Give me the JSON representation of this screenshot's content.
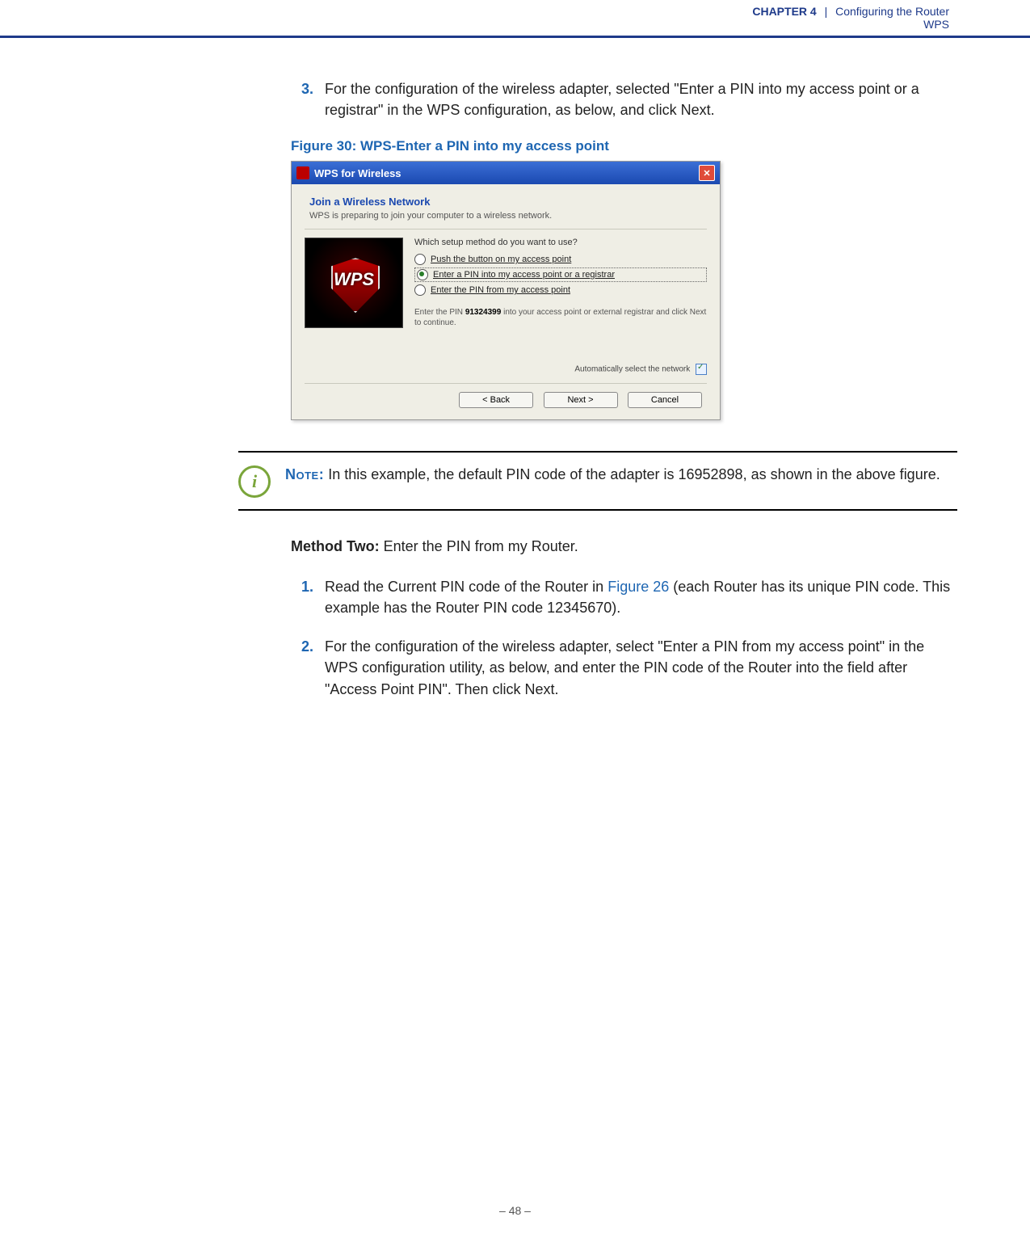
{
  "header": {
    "chapter_label": "CHAPTER 4",
    "pipe": "|",
    "title": "Configuring the Router",
    "subtitle": "WPS"
  },
  "step3": {
    "num": "3.",
    "text": "For the configuration of the wireless adapter, selected \"Enter a PIN into my access point or a registrar\" in the WPS configuration, as below, and click Next."
  },
  "figure_caption": "Figure 30:  WPS-Enter a PIN into my access point",
  "dialog": {
    "title": "WPS for Wireless",
    "join_title": "Join a Wireless Network",
    "join_sub": "WPS is preparing to join your computer to a wireless network.",
    "question": "Which setup method do you want to use?",
    "opt1": "Push the button on my access point",
    "opt2": "Enter a PIN into my access point or a registrar",
    "opt3": "Enter the PIN from my access point",
    "pin_prefix": "Enter the PIN ",
    "pin_value": "91324399",
    "pin_suffix": " into your access point or external registrar and click Next to continue.",
    "auto_label": "Automatically select the network",
    "back": "< Back",
    "next": "Next >",
    "cancel": "Cancel"
  },
  "note": {
    "label": "Note:",
    "text": " In this example, the default PIN code of the adapter is 16952898, as shown in the above figure."
  },
  "method2": {
    "bold": "Method Two:",
    "rest": " Enter the PIN from my Router."
  },
  "m2_step1": {
    "num": "1.",
    "pre": "Read the Current PIN code of the Router in ",
    "figlink": "Figure 26",
    "post": " (each Router has its unique PIN code. This example has the Router PIN code 12345670)."
  },
  "m2_step2": {
    "num": "2.",
    "text": "For the configuration of the wireless adapter, select \"Enter a PIN from my access point\" in the WPS configuration utility, as below, and enter the PIN code of the Router into the field after \"Access Point PIN\". Then click Next."
  },
  "footer": "–  48  –"
}
